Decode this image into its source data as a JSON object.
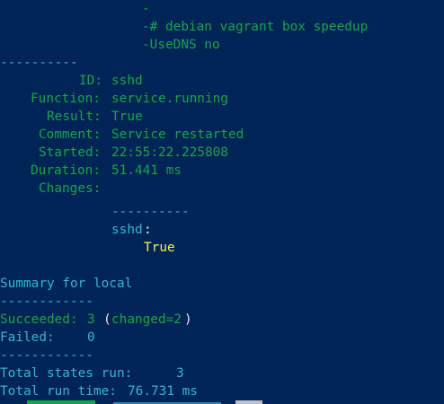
{
  "colors": {
    "background": "#012456",
    "green": "#16a34a",
    "cyan": "#35b5c9",
    "white": "#e8e8e8",
    "yellow": "#f2f25c"
  },
  "diff": {
    "minus": "-",
    "comment": "-# debian vagrant box speedup",
    "usedns": "-UseDNS no"
  },
  "separator_top": "----------",
  "state": {
    "id_label": "ID:",
    "id_value": "sshd",
    "function_label": "Function:",
    "function_value": "service.running",
    "result_label": "Result:",
    "result_value": "True",
    "comment_label": "Comment:",
    "comment_value": "Service restarted",
    "started_label": "Started:",
    "started_value": "22:55:22.225808",
    "duration_label": "Duration:",
    "duration_value": "51.441 ms",
    "changes_label": "Changes:",
    "changes_separator": "----------",
    "changes_key": "sshd",
    "changes_colon": ":",
    "changes_value": "True"
  },
  "summary": {
    "title": "Summary for local",
    "sep1": "------------",
    "succeeded_label": "Succeeded:",
    "succeeded_value": "3",
    "changed_open": "(",
    "changed_text": "changed=2",
    "changed_close": ")",
    "failed_label": "Failed:",
    "failed_value": "0",
    "sep2": "------------",
    "total_states_label": "Total states run:",
    "total_states_value": "3",
    "total_time_label": "Total run time:",
    "total_time_value": "76.731 ms"
  }
}
